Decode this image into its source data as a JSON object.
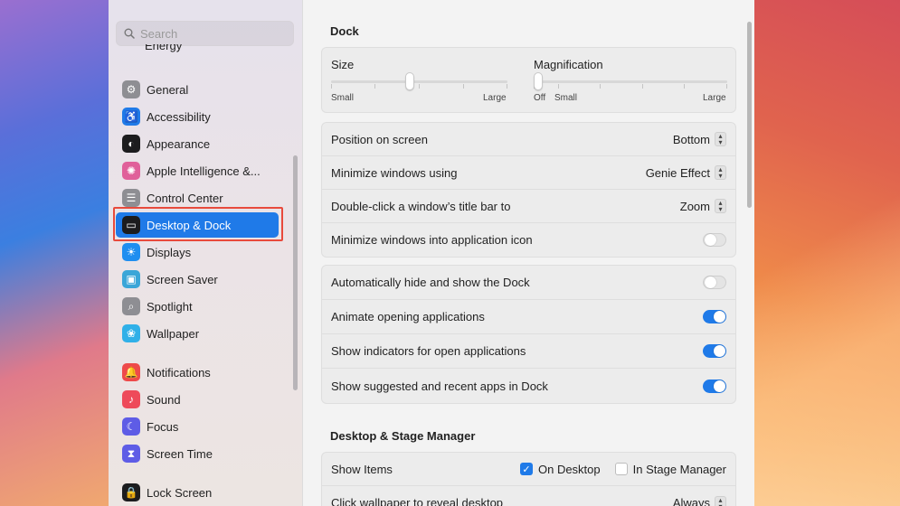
{
  "sidebar": {
    "search_placeholder": "Search",
    "cut_item": "Energy",
    "items": [
      {
        "label": "General",
        "icon": "gear-icon",
        "color": "#8e8e93"
      },
      {
        "label": "Accessibility",
        "icon": "accessibility-icon",
        "color": "#1f7ae8"
      },
      {
        "label": "Appearance",
        "icon": "appearance-icon",
        "color": "#1c1c1e"
      },
      {
        "label": "Apple Intelligence &...",
        "icon": "apple-intelligence-icon",
        "color": "#e0609a"
      },
      {
        "label": "Control Center",
        "icon": "control-center-icon",
        "color": "#8e8e93"
      },
      {
        "label": "Desktop & Dock",
        "icon": "desktop-dock-icon",
        "color": "#1c1c1e"
      },
      {
        "label": "Displays",
        "icon": "displays-icon",
        "color": "#1f8ef0"
      },
      {
        "label": "Screen Saver",
        "icon": "screen-saver-icon",
        "color": "#3aa6d8"
      },
      {
        "label": "Spotlight",
        "icon": "spotlight-icon",
        "color": "#8e8e93"
      },
      {
        "label": "Wallpaper",
        "icon": "wallpaper-icon",
        "color": "#30b0e8"
      },
      {
        "label": "Notifications",
        "icon": "notifications-icon",
        "color": "#ee4a4a"
      },
      {
        "label": "Sound",
        "icon": "sound-icon",
        "color": "#ee4a5a"
      },
      {
        "label": "Focus",
        "icon": "focus-icon",
        "color": "#5e5ce6"
      },
      {
        "label": "Screen Time",
        "icon": "screen-time-icon",
        "color": "#5e5ce6"
      },
      {
        "label": "Lock Screen",
        "icon": "lock-icon",
        "color": "#1c1c1e"
      }
    ]
  },
  "dock": {
    "title": "Dock",
    "size": {
      "label": "Size",
      "min_label": "Small",
      "max_label": "Large",
      "value": 0.42
    },
    "magnification": {
      "label": "Magnification",
      "off_label": "Off",
      "min_label": "Small",
      "max_label": "Large",
      "value": 0.0
    },
    "settings": [
      {
        "label": "Position on screen",
        "value": "Bottom"
      },
      {
        "label": "Minimize windows using",
        "value": "Genie Effect"
      },
      {
        "label": "Double-click a window’s title bar to",
        "value": "Zoom"
      },
      {
        "label": "Minimize windows into application icon",
        "toggle": false
      }
    ],
    "toggles": [
      {
        "label": "Automatically hide and show the Dock",
        "on": false
      },
      {
        "label": "Animate opening applications",
        "on": true
      },
      {
        "label": "Show indicators for open applications",
        "on": true
      },
      {
        "label": "Show suggested and recent apps in Dock",
        "on": true
      }
    ]
  },
  "stage": {
    "title": "Desktop & Stage Manager",
    "show_items_label": "Show Items",
    "on_desktop_label": "On Desktop",
    "on_desktop_checked": true,
    "in_stage_label": "In Stage Manager",
    "in_stage_checked": false,
    "click_wallpaper_label": "Click wallpaper to reveal desktop",
    "click_wallpaper_value": "Always"
  }
}
